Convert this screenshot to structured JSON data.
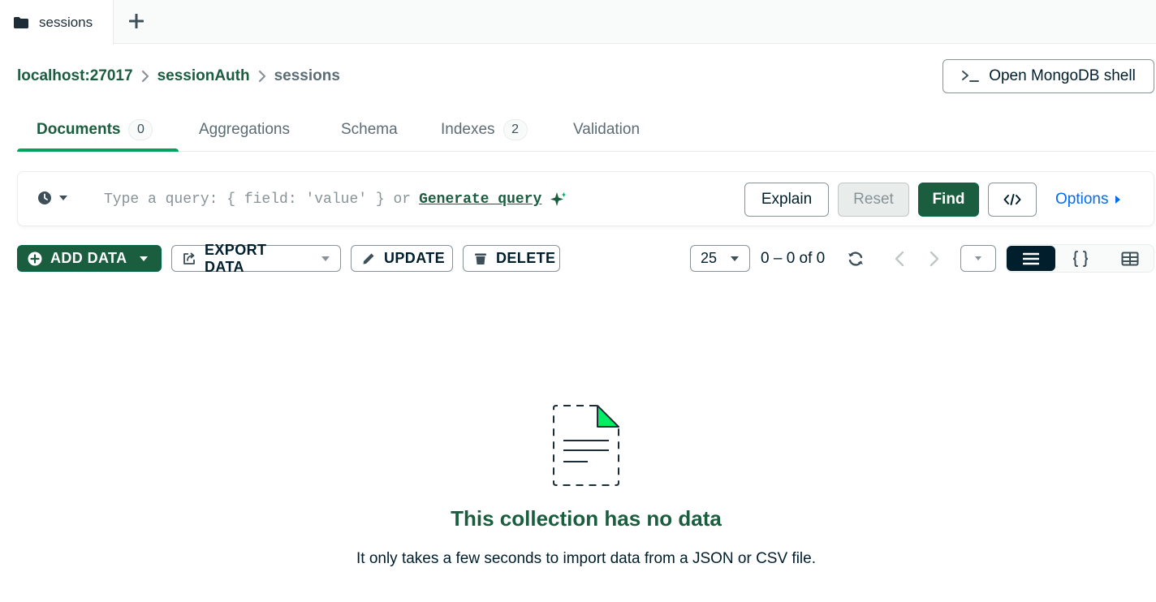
{
  "tabs": {
    "active_tab": "sessions",
    "add_tab_icon": "plus-icon"
  },
  "breadcrumb": {
    "host": "localhost:27017",
    "database": "sessionAuth",
    "collection": "sessions"
  },
  "shell_button": {
    "label": "Open MongoDB shell",
    "icon": "terminal-icon"
  },
  "collection_tabs": [
    {
      "label": "Documents",
      "count": "0",
      "active": true
    },
    {
      "label": "Aggregations"
    },
    {
      "label": "Schema"
    },
    {
      "label": "Indexes",
      "count": "2"
    },
    {
      "label": "Validation"
    }
  ],
  "query_bar": {
    "placeholder": "Type a query: { field: 'value' } or",
    "generate_link": "Generate query",
    "explain_label": "Explain",
    "reset_label": "Reset",
    "find_label": "Find",
    "options_label": "Options"
  },
  "actions": {
    "add_data": "ADD DATA",
    "export_data": "EXPORT DATA",
    "update": "UPDATE",
    "delete": "DELETE"
  },
  "pagination": {
    "page_size": "25",
    "range": "0 – 0 of 0"
  },
  "empty_state": {
    "title": "This collection has no data",
    "description": "It only takes a few seconds to import data from a JSON or CSV file."
  },
  "colors": {
    "brand_green": "#1a5d3f",
    "accent_green": "#00a35c",
    "link_blue": "#016bf8",
    "dark": "#001e2b"
  }
}
